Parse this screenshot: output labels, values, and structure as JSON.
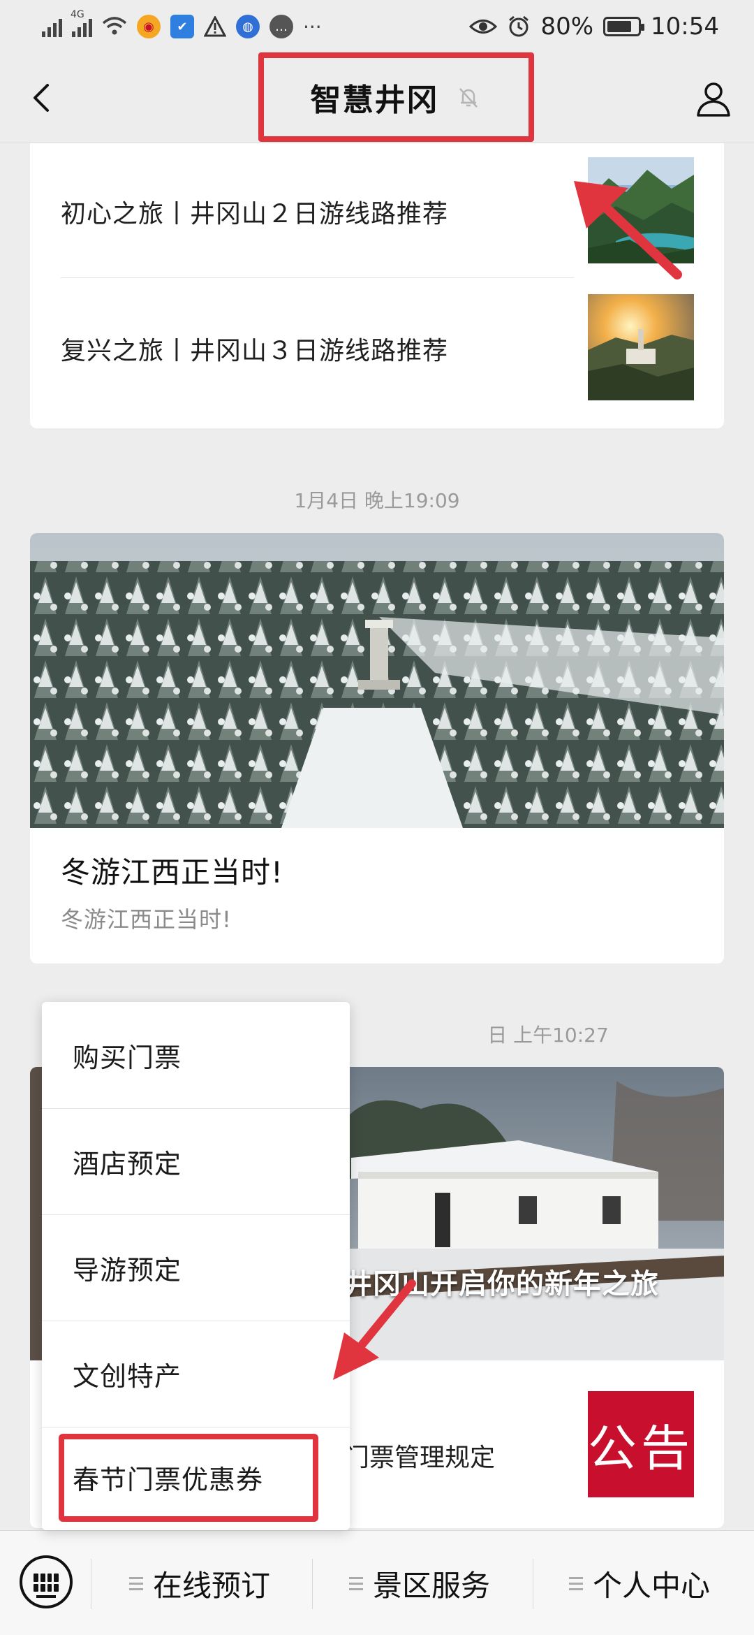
{
  "status_bar": {
    "network": "4G",
    "battery": "80%",
    "battery_level": 0.8,
    "time": "10:54",
    "icons": [
      "signal-icon",
      "wifi-icon",
      "weibo-icon",
      "shield-icon",
      "warning-icon",
      "browser-icon",
      "chat-icon",
      "more-icon",
      "eye-icon",
      "alarm-icon",
      "battery-icon"
    ]
  },
  "nav": {
    "title": "智慧井冈",
    "back_icon": "chevron-left-icon",
    "mute_icon": "bell-off-icon",
    "profile_icon": "person-icon"
  },
  "articles_top": [
    {
      "title": "初心之旅丨井冈山２日游线路推荐"
    },
    {
      "title": "复兴之旅丨井冈山３日游线路推荐"
    }
  ],
  "timestamps": [
    "1月4日 晚上19:09",
    "日 上午10:27"
  ],
  "article_main": {
    "title": "冬游江西正当时!",
    "subtitle": "冬游江西正当时!"
  },
  "article_third": {
    "overlay": "井冈山开启你的新年之旅",
    "row_title": "门票管理规定",
    "notice_label": "公告"
  },
  "popup_menu": {
    "items": [
      "购买门票",
      "酒店预定",
      "导游预定",
      "文创特产",
      "春节门票优惠券"
    ],
    "highlighted": "春节门票优惠券"
  },
  "bottom_menu": {
    "keyboard_icon": "keyboard-icon",
    "tabs": [
      "在线预订",
      "景区服务",
      "个人中心"
    ]
  },
  "colors": {
    "annotation_red": "#e0343f",
    "background": "#ededed",
    "notice_red": "#c8102e"
  }
}
